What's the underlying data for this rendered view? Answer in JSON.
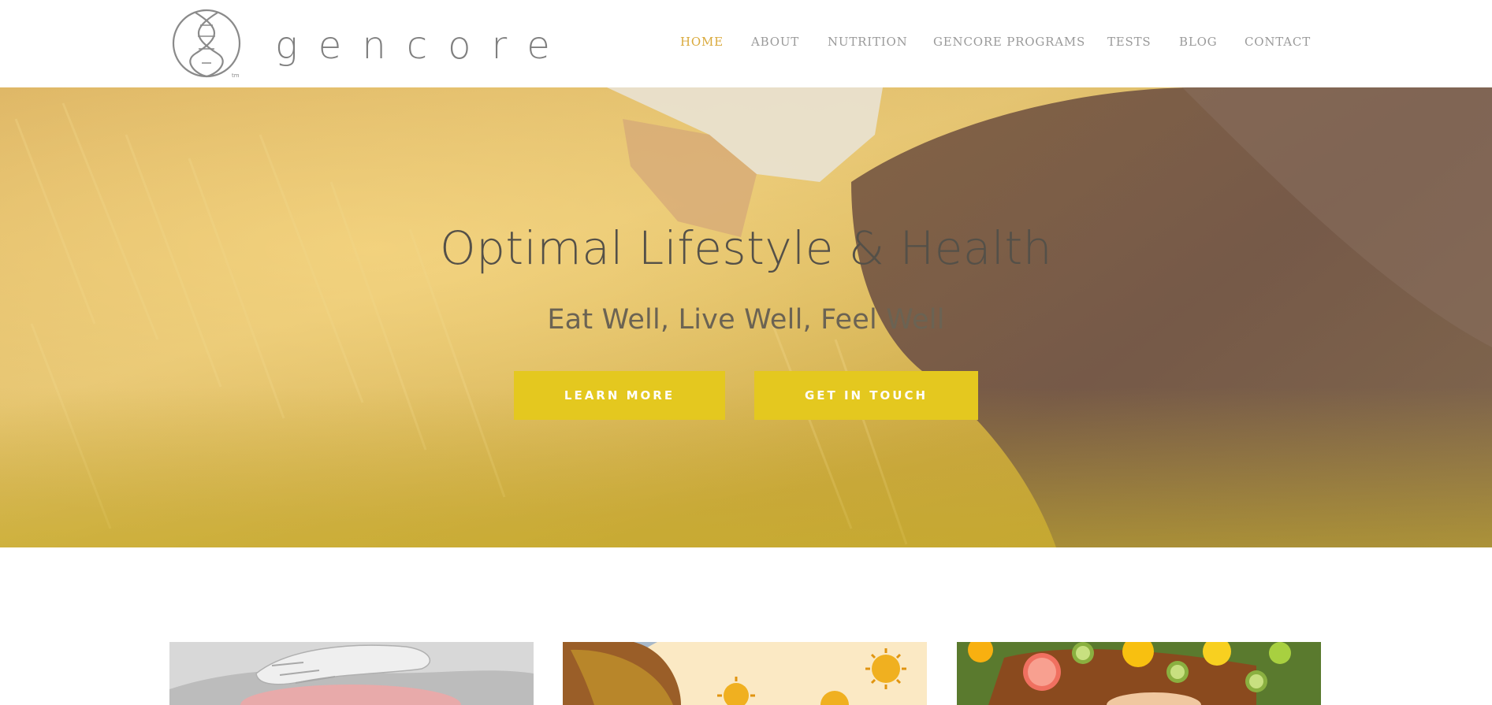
{
  "brand": {
    "name": "gencore",
    "trademark": "tm"
  },
  "nav": {
    "items": [
      {
        "label": "HOME",
        "active": true
      },
      {
        "label": "ABOUT",
        "active": false
      },
      {
        "label": "NUTRITION",
        "active": false
      },
      {
        "label": "GENCORE PROGRAMS",
        "active": false
      },
      {
        "label": "TESTS",
        "active": false
      },
      {
        "label": "BLOG",
        "active": false
      },
      {
        "label": "CONTACT",
        "active": false
      }
    ]
  },
  "hero": {
    "title": "Optimal Lifestyle & Health",
    "subtitle": "Eat Well, Live Well, Feel Well",
    "learn_more": "LEARN MORE",
    "get_in_touch": "GET IN TOUCH"
  },
  "cards": [
    {
      "icon": "back-pain-image"
    },
    {
      "icon": "sun-illustration-image"
    },
    {
      "icon": "citrus-fruit-image"
    }
  ],
  "colors": {
    "accent": "#d9a93b",
    "button": "#e4c81f",
    "nav_text": "#9a9a9a"
  }
}
